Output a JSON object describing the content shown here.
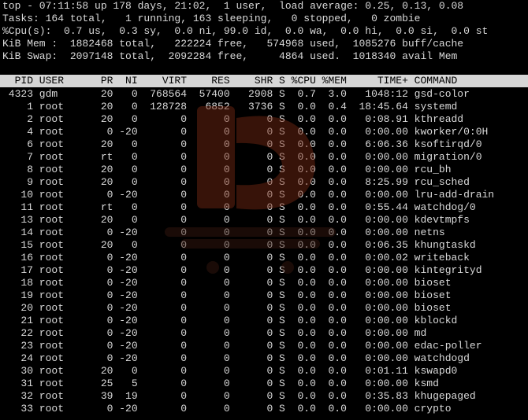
{
  "summary": {
    "uptime_line": "top - 07:11:58 up 178 days, 21:02,  1 user,  load average: 0.25, 0.13, 0.08",
    "tasks_line": "Tasks: 164 total,   1 running, 163 sleeping,   0 stopped,   0 zombie",
    "cpu_line": "%Cpu(s):  0.7 us,  0.3 sy,  0.0 ni, 99.0 id,  0.0 wa,  0.0 hi,  0.0 si,  0.0 st",
    "mem_line": "KiB Mem :  1882468 total,   222224 free,   574968 used,  1085276 buff/cache",
    "swap_line": "KiB Swap:  2097148 total,  2092284 free,     4864 used.  1018340 avail Mem"
  },
  "table": {
    "header": "  PID USER      PR  NI    VIRT    RES    SHR S %CPU %MEM     TIME+ COMMAND",
    "rows": [
      " 4323 gdm       20   0  768564  57400   2908 S  0.7  3.0   1048:12 gsd-color",
      "    1 root      20   0  128728   6852   3736 S  0.0  0.4  18:45.64 systemd",
      "    2 root      20   0       0      0      0 S  0.0  0.0   0:08.91 kthreadd",
      "    4 root       0 -20       0      0      0 S  0.0  0.0   0:00.00 kworker/0:0H",
      "    6 root      20   0       0      0      0 S  0.0  0.0   6:06.36 ksoftirqd/0",
      "    7 root      rt   0       0      0      0 S  0.0  0.0   0:00.00 migration/0",
      "    8 root      20   0       0      0      0 S  0.0  0.0   0:00.00 rcu_bh",
      "    9 root      20   0       0      0      0 S  0.0  0.0   8:25.99 rcu_sched",
      "   10 root       0 -20       0      0      0 S  0.0  0.0   0:00.00 lru-add-drain",
      "   11 root      rt   0       0      0      0 S  0.0  0.0   0:55.44 watchdog/0",
      "   13 root      20   0       0      0      0 S  0.0  0.0   0:00.00 kdevtmpfs",
      "   14 root       0 -20       0      0      0 S  0.0  0.0   0:00.00 netns",
      "   15 root      20   0       0      0      0 S  0.0  0.0   0:06.35 khungtaskd",
      "   16 root       0 -20       0      0      0 S  0.0  0.0   0:00.02 writeback",
      "   17 root       0 -20       0      0      0 S  0.0  0.0   0:00.00 kintegrityd",
      "   18 root       0 -20       0      0      0 S  0.0  0.0   0:00.00 bioset",
      "   19 root       0 -20       0      0      0 S  0.0  0.0   0:00.00 bioset",
      "   20 root       0 -20       0      0      0 S  0.0  0.0   0:00.00 bioset",
      "   21 root       0 -20       0      0      0 S  0.0  0.0   0:00.00 kblockd",
      "   22 root       0 -20       0      0      0 S  0.0  0.0   0:00.00 md",
      "   23 root       0 -20       0      0      0 S  0.0  0.0   0:00.00 edac-poller",
      "   24 root       0 -20       0      0      0 S  0.0  0.0   0:00.00 watchdogd",
      "   30 root      20   0       0      0      0 S  0.0  0.0   0:01.11 kswapd0",
      "   31 root      25   5       0      0      0 S  0.0  0.0   0:00.00 ksmd",
      "   32 root      39  19       0      0      0 S  0.0  0.0   0:35.83 khugepaged",
      "   33 root       0 -20       0      0      0 S  0.0  0.0   0:00.00 crypto"
    ]
  },
  "colors": {
    "background": "#000000",
    "text": "#d9d9d9",
    "header_bar_bg": "#d6d6d6",
    "header_bar_text": "#000000",
    "watermark": "#7a2a14"
  },
  "icons": {
    "watermark": "brand-logo-watermark"
  }
}
